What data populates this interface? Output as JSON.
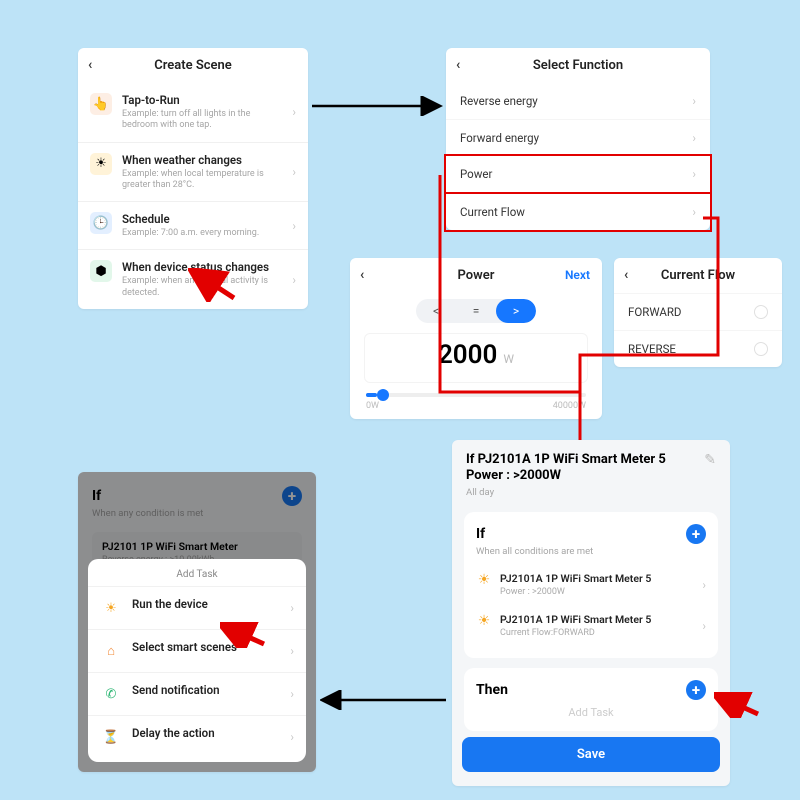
{
  "createScene": {
    "title": "Create Scene",
    "items": [
      {
        "icon": "👆",
        "iconBg": "#fdeee4",
        "title": "Tap-to-Run",
        "subtitle": "Example: turn off all lights in the bedroom with one tap."
      },
      {
        "icon": "☀",
        "iconBg": "#fff3d8",
        "title": "When weather changes",
        "subtitle": "Example: when local temperature is greater than 28°C."
      },
      {
        "icon": "🕒",
        "iconBg": "#e3efff",
        "title": "Schedule",
        "subtitle": "Example: 7:00 a.m. every morning."
      },
      {
        "icon": "⬢",
        "iconBg": "#e2f7ea",
        "title": "When device status changes",
        "subtitle": "Example: when an unusual activity is detected."
      }
    ]
  },
  "selectFunction": {
    "title": "Select Function",
    "items": [
      "Reverse energy",
      "Forward energy",
      "Power",
      "Current Flow"
    ]
  },
  "power": {
    "title": "Power",
    "next": "Next",
    "ops": [
      "<",
      "=",
      ">"
    ],
    "activeOp": ">",
    "value": "2000",
    "unit": "W",
    "range": [
      "0W",
      "40000W"
    ]
  },
  "currentFlow": {
    "title": "Current Flow",
    "options": [
      "FORWARD",
      "REVERSE"
    ]
  },
  "ifPanel": {
    "title": "If",
    "subtitle": "When any condition is met",
    "deviceLine": "PJ2101 1P WiFi Smart Meter",
    "deviceSub": "Reverse energy : >10.00kWh"
  },
  "addTask": {
    "title": "Add Task",
    "items": [
      {
        "icon": "☀",
        "color": "#f5a623",
        "label": "Run the device"
      },
      {
        "icon": "⌂",
        "color": "#f28c3b",
        "label": "Select smart scenes"
      },
      {
        "icon": "✆",
        "color": "#2bb673",
        "label": "Send notification"
      },
      {
        "icon": "⏳",
        "color": "#2f6fd1",
        "label": "Delay the action"
      }
    ]
  },
  "summary": {
    "heading": "If PJ2101A 1P WiFi Smart Meter  5 Power : >2000W",
    "sub": "All day",
    "ifCard": {
      "title": "If",
      "subtitle": "When all conditions are met",
      "conds": [
        {
          "device": "PJ2101A 1P WiFi Smart Meter 5",
          "cond": "Power : >2000W"
        },
        {
          "device": "PJ2101A 1P WiFi Smart Meter 5",
          "cond": "Current Flow:FORWARD"
        }
      ]
    },
    "thenLabel": "Then",
    "addTask": "Add Task",
    "save": "Save"
  }
}
